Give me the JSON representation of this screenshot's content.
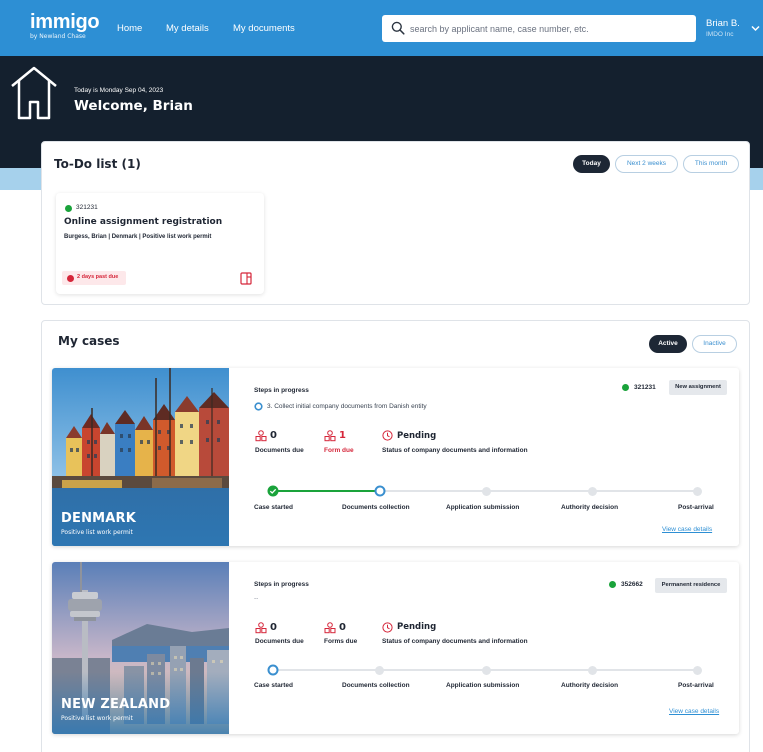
{
  "nav": {
    "logo": "immigo",
    "logo_sub": "by Newland Chase",
    "links": [
      "Home",
      "My details",
      "My documents"
    ],
    "search_placeholder": "search by applicant name, case number, etc.",
    "user_name": "Brian B.",
    "user_org": "IMDO Inc"
  },
  "hero": {
    "date": "Today is Monday Sep 04, 2023",
    "welcome": "Welcome, Brian"
  },
  "todo": {
    "title": "To-Do list (1)",
    "filters": [
      "Today",
      "Next 2 weeks",
      "This month"
    ],
    "active_filter": "Today",
    "item": {
      "case_number": "321231",
      "title": "Online assignment registration",
      "subtitle": "Burgess, Brian | Denmark | Positive list work permit",
      "due": "2 days past due"
    }
  },
  "cases": {
    "title": "My cases",
    "filters": [
      "Active",
      "Inactive"
    ],
    "active_filter": "Active",
    "items": [
      {
        "country": "DENMARK",
        "permit": "Positive list work permit",
        "steps_label": "Steps in progress",
        "step": "3. Collect initial company documents from Danish entity",
        "case_number": "321231",
        "type": "New assignment",
        "docs_due_count": "0",
        "docs_due_label": "Documents due",
        "forms_count": "1",
        "forms_label": "Form due",
        "status": "Pending",
        "status_label": "Status of company documents and information",
        "stages": [
          "Case started",
          "Documents collection",
          "Application submission",
          "Authority decision",
          "Post-arrival"
        ],
        "current_stage": 1,
        "link": "View case details"
      },
      {
        "country": "NEW ZEALAND",
        "permit": "Positive list work permit",
        "steps_label": "Steps in progress",
        "step": "--",
        "case_number": "352662",
        "type": "Permanent residence",
        "docs_due_count": "0",
        "docs_due_label": "Documents due",
        "forms_count": "0",
        "forms_label": "Forms due",
        "status": "Pending",
        "status_label": "Status of company documents and information",
        "stages": [
          "Case started",
          "Documents collection",
          "Application submission",
          "Authority decision",
          "Post-arrival"
        ],
        "current_stage": 0,
        "link": "View case details"
      }
    ]
  },
  "colors": {
    "nav": "#2d8fd4",
    "hero": "#14202e",
    "band": "#a6d1ec",
    "accent": "#3a8fcf",
    "progress_done": "#1aa33b",
    "alert": "#d5263a"
  }
}
